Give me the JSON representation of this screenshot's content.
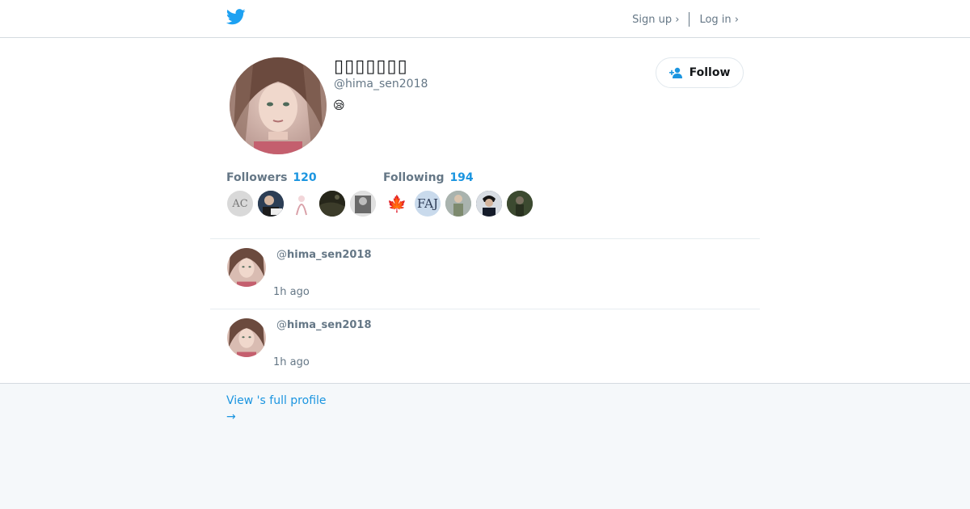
{
  "header": {
    "signup_label": "Sign up ›",
    "login_label": "Log in ›"
  },
  "profile": {
    "display_name": "▯▯▯▯▯▯▯",
    "handle": "@hima_sen2018",
    "bio": "😪",
    "follow_label": "Follow"
  },
  "stats": {
    "followers_label": "Followers",
    "followers_count": "120",
    "following_label": "Following",
    "following_count": "194"
  },
  "followers_thumbs": [
    {
      "text": "AC"
    },
    {
      "text": ""
    },
    {
      "text": ""
    },
    {
      "text": ""
    },
    {
      "text": ""
    }
  ],
  "following_thumbs": [
    {
      "text": "🍁"
    },
    {
      "text": "FAJ"
    },
    {
      "text": ""
    },
    {
      "text": ""
    },
    {
      "text": ""
    }
  ],
  "tweets": [
    {
      "at": "@",
      "handle": "hima_sen2018",
      "time": "1h ago"
    },
    {
      "at": "@",
      "handle": "hima_sen2018",
      "time": "1h ago"
    }
  ],
  "footer": {
    "view_profile": "View 's full profile",
    "arrow": "→"
  },
  "colors": {
    "accent": "#1b95e0",
    "bird": "#1da1f2",
    "muted": "#657786",
    "footer_bg": "#f5f8fa"
  }
}
